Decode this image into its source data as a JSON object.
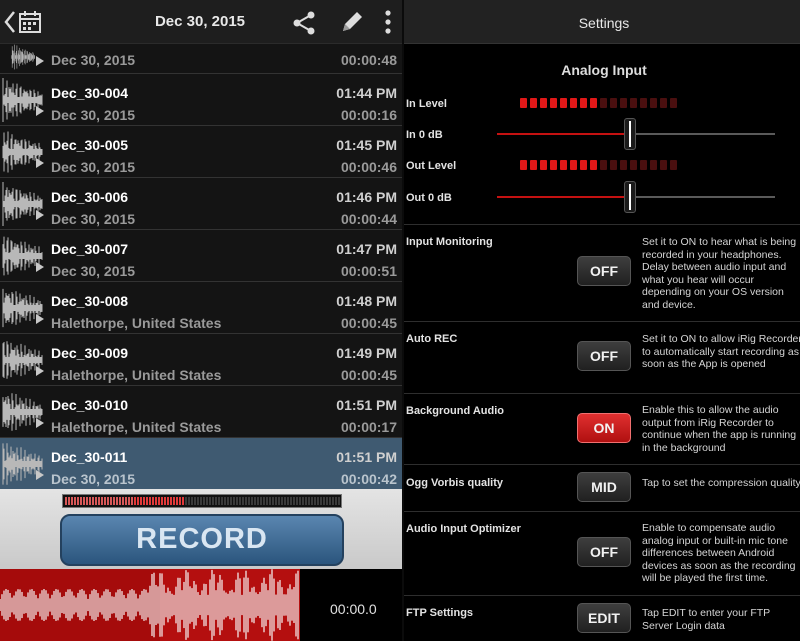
{
  "left": {
    "header": {
      "title": "Dec 30, 2015"
    },
    "recordings": [
      {
        "name": "",
        "sub": "Dec 30, 2015",
        "time": "",
        "duration": "00:00:48"
      },
      {
        "name": "Dec_30-004",
        "sub": "Dec 30, 2015",
        "time": "01:44 PM",
        "duration": "00:00:16"
      },
      {
        "name": "Dec_30-005",
        "sub": "Dec 30, 2015",
        "time": "01:45 PM",
        "duration": "00:00:46"
      },
      {
        "name": "Dec_30-006",
        "sub": "Dec 30, 2015",
        "time": "01:46 PM",
        "duration": "00:00:44"
      },
      {
        "name": "Dec_30-007",
        "sub": "Dec 30, 2015",
        "time": "01:47 PM",
        "duration": "00:00:51"
      },
      {
        "name": "Dec_30-008",
        "sub": "Halethorpe, United States",
        "time": "01:48 PM",
        "duration": "00:00:45"
      },
      {
        "name": "Dec_30-009",
        "sub": "Halethorpe, United States",
        "time": "01:49 PM",
        "duration": "00:00:45"
      },
      {
        "name": "Dec_30-010",
        "sub": "Halethorpe, United States",
        "time": "01:51 PM",
        "duration": "00:00:17"
      },
      {
        "name": "Dec_30-011",
        "sub": "Dec 30, 2015",
        "time": "01:51 PM",
        "duration": "00:00:42",
        "selected": true
      }
    ],
    "record_button": "RECORD",
    "input_meter_level": 0.43,
    "current_time": "00:00.0"
  },
  "right": {
    "header": {
      "title": "Settings"
    },
    "section_title": "Analog Input",
    "levels": {
      "in_level_label": "In Level",
      "in_level_lit": 8,
      "in_gain_label": "In 0 dB",
      "in_gain_pos": 0.5,
      "out_level_label": "Out Level",
      "out_level_lit": 8,
      "out_gain_label": "Out 0 dB",
      "out_gain_pos": 0.5,
      "led_count": 16
    },
    "settings": [
      {
        "label": "Input Monitoring",
        "button": "OFF",
        "on": false,
        "desc": "Set it to ON to hear what is being recorded in your headphones. Delay between audio input and what you hear will occur depending on your OS version and device."
      },
      {
        "label": "Auto REC",
        "button": "OFF",
        "on": false,
        "desc": "Set it to ON to allow iRig Recorder to automatically start recording as soon as the App is opened"
      },
      {
        "label": "Background Audio",
        "button": "ON",
        "on": true,
        "desc": "Enable this to allow the audio output from iRig Recorder to continue when the app is running in the background"
      },
      {
        "label": "Ogg Vorbis quality",
        "button": "MID",
        "on": false,
        "desc": "Tap to set the compression quality"
      },
      {
        "label": "Audio Input Optimizer",
        "button": "OFF",
        "on": false,
        "desc": "Enable to compensate audio analog input or built-in mic tone differences between Android devices as soon as the recording will be played the first time."
      },
      {
        "label": "FTP Settings",
        "button": "EDIT",
        "on": false,
        "desc": "Tap EDIT to enter your FTP Server Login data"
      }
    ]
  },
  "colors": {
    "accent_red": "#c51111",
    "selected_row": "#3f5a71",
    "record_blue": "#2b557d"
  }
}
